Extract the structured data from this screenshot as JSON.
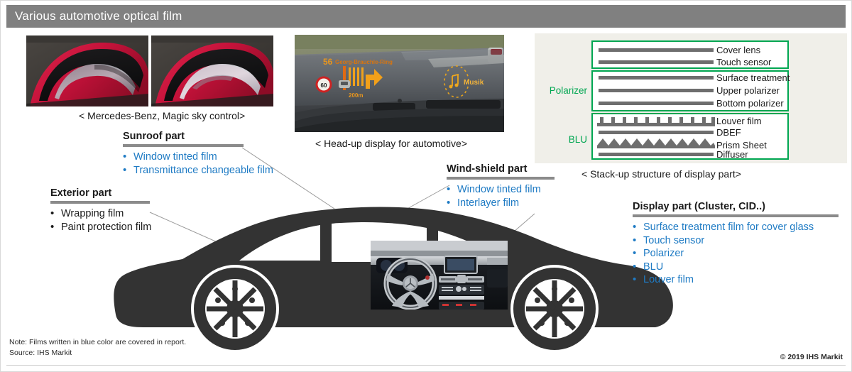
{
  "title": "Various automotive optical film",
  "captions": {
    "sunroof_photo": "< Mercedes-Benz, Magic sky control>",
    "hud_photo": "< Head-up display for automotive>",
    "stackup": "< Stack-up structure of display part>"
  },
  "hud_overlay": {
    "speed": "56",
    "street": "Georg-Brauchle-Ring",
    "distance": "200m",
    "speed_limit": "60",
    "media_label": "Musik"
  },
  "callouts": [
    {
      "id": "sunroof",
      "heading": "Sunroof part",
      "color": "#1f7bc4",
      "items": [
        "Window tinted film",
        "Transmittance changeable film"
      ]
    },
    {
      "id": "exterior",
      "heading": "Exterior part",
      "color": "#1a1a1a",
      "items": [
        "Wrapping film",
        "Paint protection film"
      ]
    },
    {
      "id": "windshield",
      "heading": "Wind-shield part",
      "color": "#1f7bc4",
      "items": [
        "Window tinted film",
        "Interlayer film"
      ]
    },
    {
      "id": "display",
      "heading": "Display part (Cluster, CID..)",
      "color": "#1f7bc4",
      "items": [
        "Surface treatment film for cover glass",
        "Touch sensor",
        "Polarizer",
        "BLU",
        "Louver film"
      ]
    }
  ],
  "stackup": {
    "group_labels": {
      "polarizer": "Polarizer",
      "blu": "BLU"
    },
    "groups": [
      {
        "name": "cover",
        "layers": [
          "Cover lens",
          "Touch sensor"
        ]
      },
      {
        "name": "polarizer",
        "layers": [
          "Surface treatment",
          "Upper polarizer",
          "Bottom polarizer"
        ]
      },
      {
        "name": "blu",
        "layers": [
          "Louver film",
          "DBEF",
          "Prism Sheet",
          "Diffuser"
        ]
      }
    ]
  },
  "footer": {
    "note_line1": "Note: Films written in blue color are covered in report.",
    "note_line2": "Source: IHS Markit",
    "copyright": "© 2019 IHS Markit"
  },
  "colors": {
    "title_bar": "#808080",
    "accent_blue": "#1f7bc4",
    "accent_green": "#00a651",
    "layer_gray": "#6e6e6e",
    "panel_bg": "#f0efe9",
    "car_body": "#333333"
  }
}
